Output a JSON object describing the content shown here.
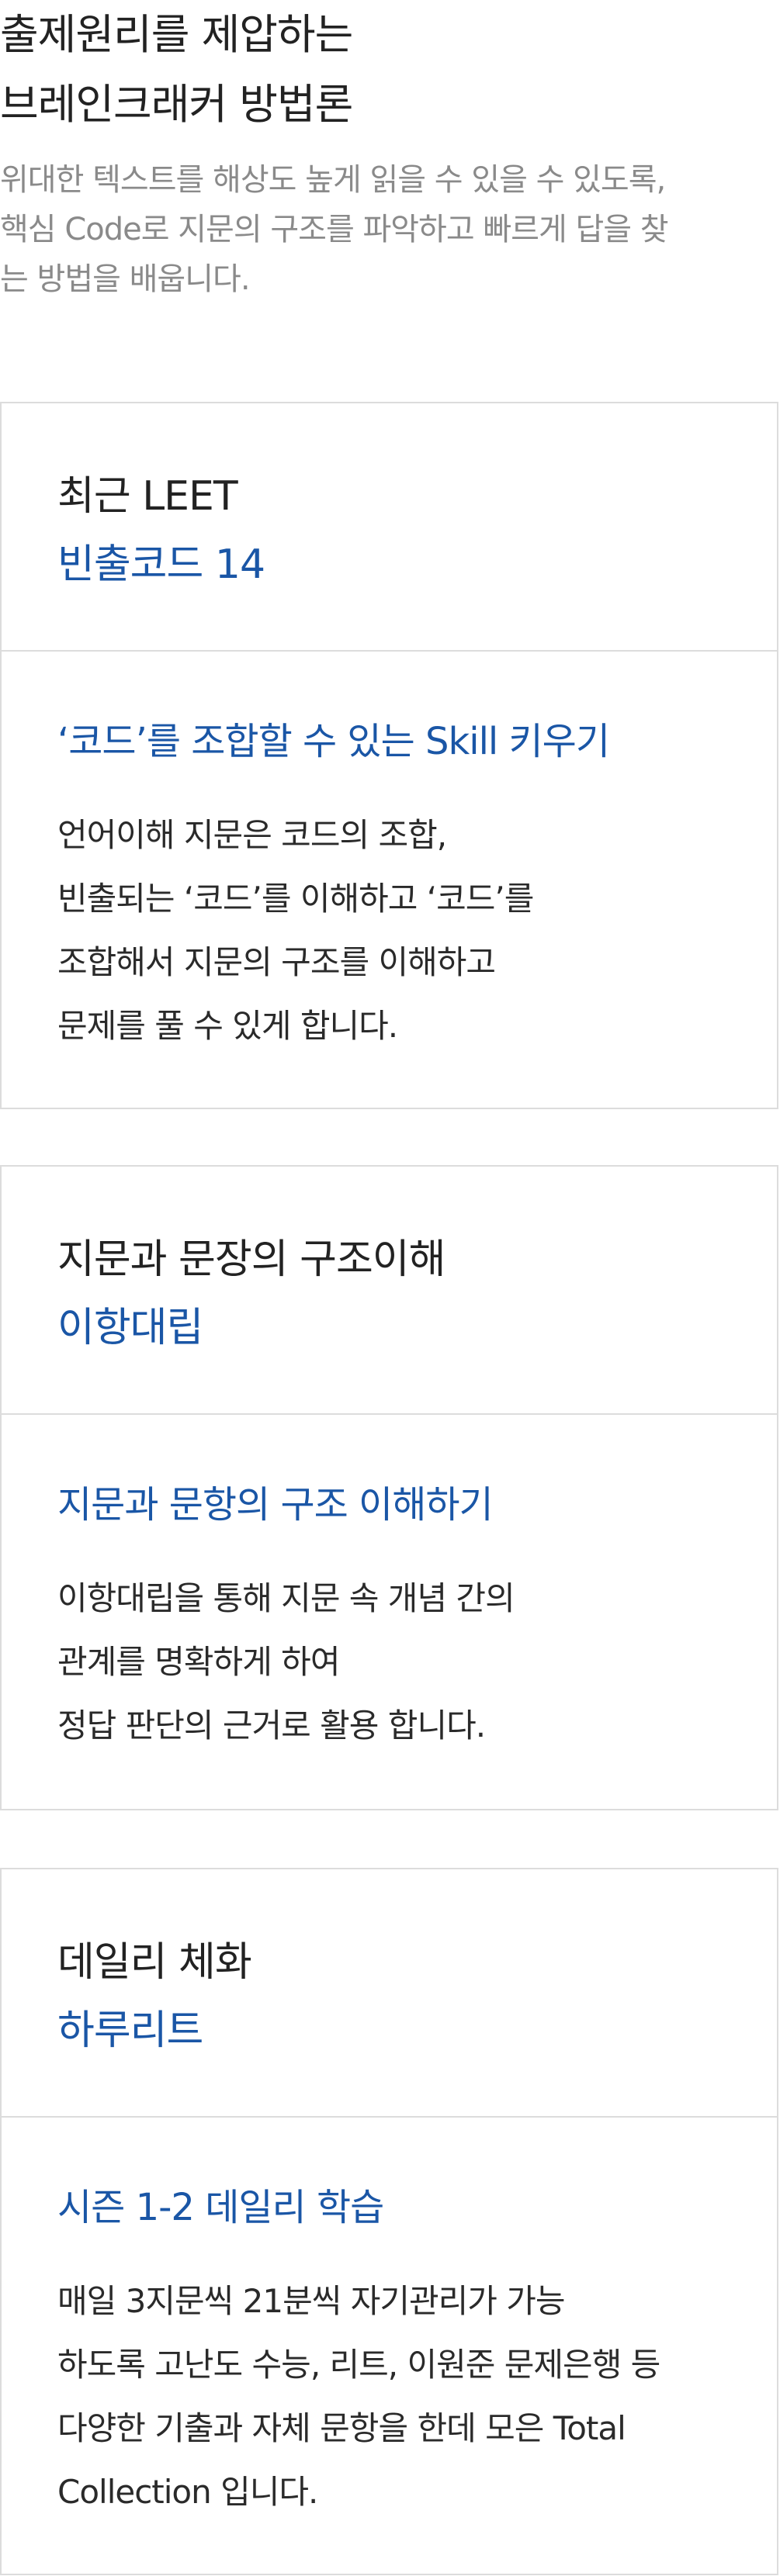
{
  "hero": {
    "title_line1": "출제원리를 제압하는",
    "title_line2": "브레인크래커 방법론",
    "desc_line1": "위대한 텍스트를 해상도 높게 읽을 수 있을 수 있도록,",
    "desc_line2": "핵심 Code로 지문의 구조를 파악하고 빠르게 답을 찾",
    "desc_line3": "는 방법을 배웁니다."
  },
  "cards": [
    {
      "subtitle": "최근 LEET",
      "title": "빈출코드 14",
      "heading": "‘코드’를 조합할 수 있는 Skill 키우기",
      "lines": [
        "언어이해 지문은 코드의 조합,",
        "빈출되는 ‘코드’를 이해하고 ‘코드’를",
        "조합해서 지문의 구조를 이해하고",
        "문제를 풀 수 있게 합니다."
      ]
    },
    {
      "subtitle": "지문과 문장의 구조이해",
      "title": "이항대립",
      "heading": "지문과 문항의 구조 이해하기",
      "lines": [
        "이항대립을 통해 지문 속 개념 간의",
        "관계를 명확하게 하여",
        "정답 판단의 근거로 활용 합니다."
      ]
    },
    {
      "subtitle": "데일리 체화",
      "title": "하루리트",
      "heading": "시즌 1-2 데일리 학습",
      "lines": [
        "매일 3지문씩 21분씩 자기관리가 가능",
        "하도록 고난도 수능, 리트, 이원준 문제은행 등",
        "다양한 기출과 자체 문항을 한데 모은 Total",
        "Collection 입니다."
      ]
    }
  ]
}
